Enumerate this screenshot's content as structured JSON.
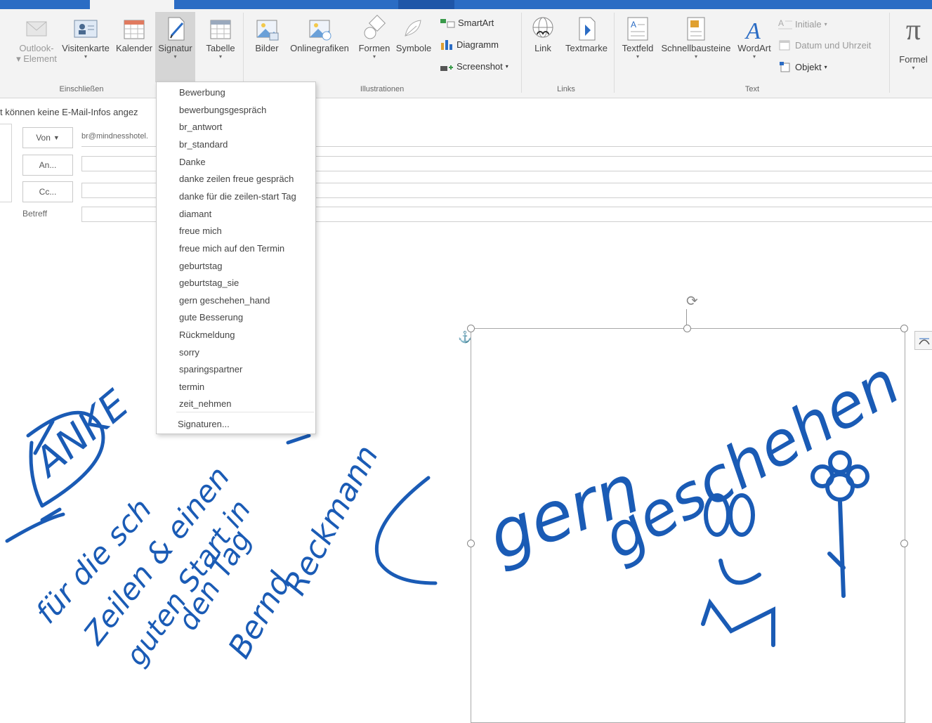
{
  "ribbon": {
    "buttons": {
      "outlook_element": {
        "label1": "Outlook-",
        "label2": "Element"
      },
      "visitenkarte": "Visitenkarte",
      "kalender": "Kalender",
      "signatur": "Signatur",
      "tabelle": "Tabelle",
      "bilder": "Bilder",
      "onlinegrafiken": "Onlinegrafiken",
      "formen": "Formen",
      "symbole": "Symbole",
      "smartart": "SmartArt",
      "diagramm": "Diagramm",
      "screenshot": "Screenshot",
      "link": "Link",
      "textmarke": "Textmarke",
      "textfeld": "Textfeld",
      "schnellbausteine": "Schnellbausteine",
      "wordart": "WordArt",
      "initiale": "Initiale",
      "datum_uhrzeit": "Datum und Uhrzeit",
      "objekt": "Objekt",
      "formel": "Formel"
    },
    "groups": {
      "einschliessen": "Einschließen",
      "illustrationen": "Illustrationen",
      "links": "Links",
      "text": "Text"
    }
  },
  "info_bar": "t können keine E-Mail-Infos angez",
  "header": {
    "von_label": "Von",
    "von_value": "br@mindnesshotel.",
    "an_label": "An...",
    "cc_label": "Cc...",
    "betreff_label": "Betreff"
  },
  "signature_menu": {
    "items": [
      "Bewerbung",
      "bewerbungsgespräch",
      "br_antwort",
      "br_standard",
      "Danke",
      "danke zeilen freue gespräch",
      "danke für die zeilen-start Tag",
      "diamant",
      "freue mich",
      "freue mich auf den Termin",
      "geburtstag",
      "geburtstag_sie",
      "gern geschehen_hand",
      "gute Besserung",
      "Rückmeldung",
      "sorry",
      "sparingspartner",
      "termin",
      "zeit_nehmen"
    ],
    "footer": "Signaturen..."
  },
  "colors": {
    "accent": "#2b6cc4",
    "ink": "#1a5bb5",
    "ribbon_bg": "#f3f3f3"
  },
  "handwriting": {
    "left_note": "DANKE für die schönen Zeilen & einen guten Start in den Tag Bernd Reckmann",
    "right_note": "gern geschehen"
  }
}
